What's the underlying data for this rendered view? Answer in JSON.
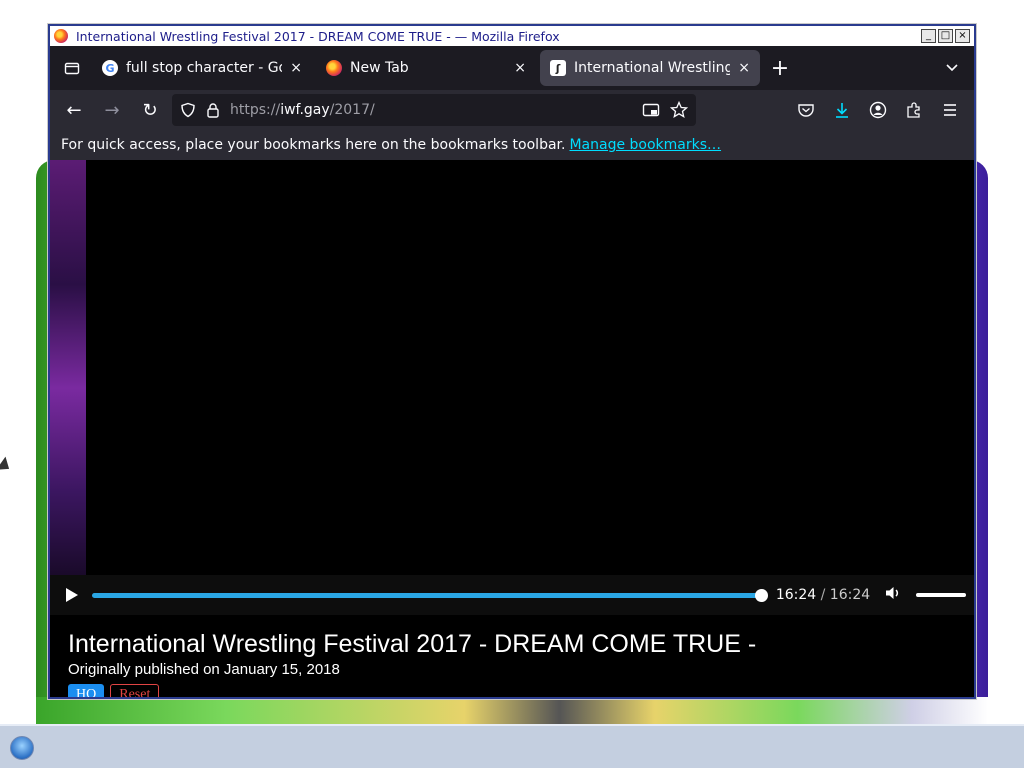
{
  "window": {
    "title": "International Wrestling Festival 2017 - DREAM COME TRUE - — Mozilla Firefox",
    "controls": {
      "minimize": "_",
      "maximize": "□",
      "close": "×"
    }
  },
  "tabs": [
    {
      "label": "full stop character - Goo",
      "icon": "google-icon",
      "active": false
    },
    {
      "label": "New Tab",
      "icon": "firefox-icon",
      "active": false
    },
    {
      "label": "International Wrestling F",
      "icon": "site-icon",
      "active": true
    }
  ],
  "tab_close": "×",
  "newtab": "+",
  "tab_overflow": "⌄",
  "nav": {
    "back": "←",
    "forward": "→",
    "reload": "↻",
    "url_proto": "https://",
    "url_host": "iwf.gay",
    "url_path": "/2017/"
  },
  "bookmarks": {
    "message": "For quick access, place your bookmarks here on the bookmarks toolbar.",
    "link": "Manage bookmarks…"
  },
  "player": {
    "progress": 1.0,
    "current_time": "16:24",
    "separator": "/",
    "total_time": "16:24",
    "volume": 1.0
  },
  "video": {
    "title": "International Wrestling Festival 2017 - DREAM COME TRUE -",
    "published": "Originally published on January 15, 2018",
    "hq_label": "HQ",
    "reset_label": "Reset"
  }
}
